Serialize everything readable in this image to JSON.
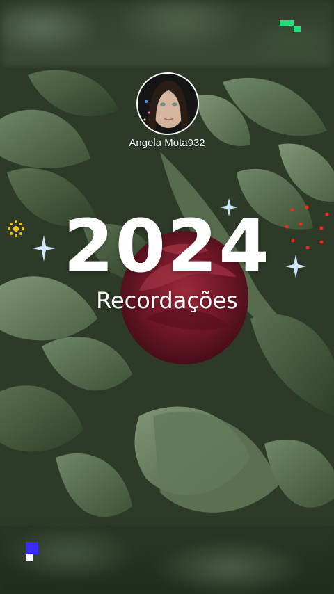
{
  "profile": {
    "username": "Angela Mota932"
  },
  "card": {
    "year": "2024",
    "subtitle": "Recordações"
  },
  "icons": {
    "top_right": "green-pixel-logo-icon",
    "bottom_left": "blue-pixel-logo-icon",
    "sparkles": "four-point-star-icon",
    "sun": "sun-dots-icon"
  },
  "colors": {
    "text": "#ffffff",
    "leaf_dark": "#2c3a27",
    "leaf_light": "#6f8667",
    "rose": "#7a1c2c",
    "accent_green": "#22e07a",
    "accent_blue": "#3a2bff",
    "sparkle": "#cfe6ff",
    "sun": "#f2c21b",
    "dots": "#ff2a1a"
  }
}
